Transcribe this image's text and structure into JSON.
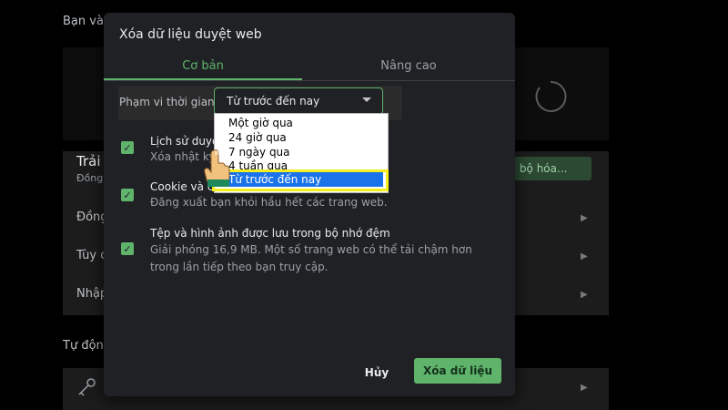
{
  "background": {
    "top_label": "Bạn và",
    "section_label": "Trải",
    "section_sub": "Đồng",
    "rows": [
      "Đồng",
      "Tùy c",
      "Nhập"
    ],
    "sync_button": "ồng bộ hóa...",
    "auto_label": "Tự động"
  },
  "dialog": {
    "title": "Xóa dữ liệu duyệt web",
    "tabs": [
      {
        "label": "Cơ bản"
      },
      {
        "label": "Nâng cao"
      }
    ],
    "time_range": {
      "label": "Phạm vi thời gian",
      "selected": "Từ trước đến nay"
    },
    "items": [
      {
        "title": "Lịch sử duyệt",
        "desc": "Xóa nhật ký"
      },
      {
        "title": "Cookie và ca",
        "desc": "Đăng xuất bạn khỏi hầu hết các trang web."
      },
      {
        "title": "Tệp và hình ảnh được lưu trong bộ nhớ đệm",
        "desc": "Giải phóng 16,9 MB. Một số trang web có thể tải chậm hơn trong lần tiếp theo bạn truy cập."
      }
    ],
    "cancel_label": "Hủy",
    "clear_label": "Xóa dữ liệu"
  },
  "dropdown": {
    "options": [
      "Một giờ qua",
      "24 giờ qua",
      "7 ngày qua",
      "4 tuần qua",
      "Từ trước đến nay"
    ]
  },
  "colors": {
    "accent": "#5fb36b",
    "dialog_bg": "#202124",
    "highlight": "#f5ee1d",
    "selected_option": "#1a73e8"
  }
}
